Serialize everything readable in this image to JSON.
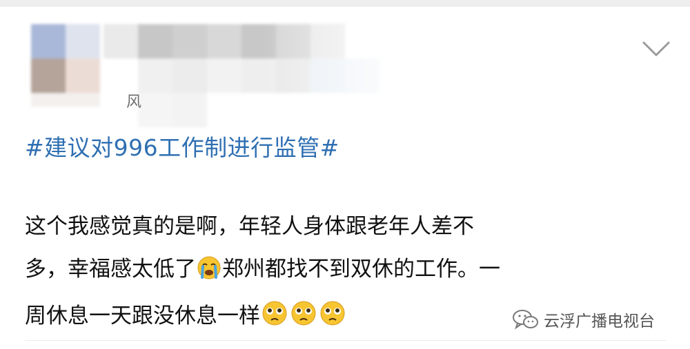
{
  "post": {
    "source_char": "风",
    "hashtag": "#建议对996工作制进行监管#",
    "lines": [
      {
        "text": "这个我感觉真的是啊，年轻人身体跟老年人差不"
      },
      {
        "before": "多，幸福感太低了",
        "emoji": "crying-face",
        "after": "郑州都找不到双休的工作。一"
      },
      {
        "text": "周休息一天跟没休息一样",
        "emojis": [
          "pleading-face",
          "pleading-face",
          "pleading-face"
        ]
      }
    ]
  },
  "watermark": {
    "label": "云浮广播电视台",
    "icon": "wechat-channel-icon"
  },
  "colors": {
    "hashtag": "#2f6fb2",
    "text": "#111111",
    "emoji_yellow": "#f7c531",
    "tear_blue": "#4aa3e0"
  }
}
